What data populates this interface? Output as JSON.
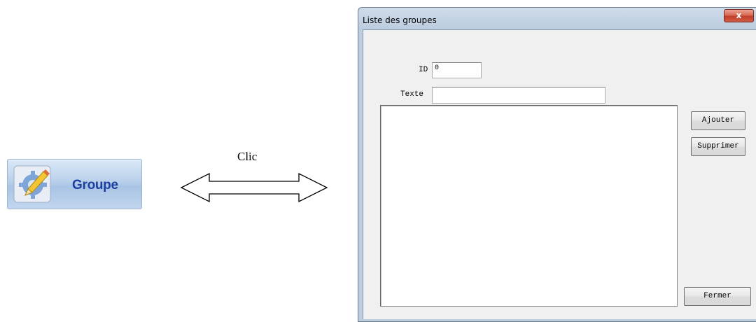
{
  "launcher": {
    "label": "Groupe",
    "icon": "edit-settings-icon"
  },
  "annotation": {
    "label": "Clic"
  },
  "dialog": {
    "title": "Liste des groupes",
    "close_label": "x",
    "id_label": "ID",
    "id_value": "0",
    "texte_label": "Texte",
    "texte_value": "",
    "buttons": {
      "add": "Ajouter",
      "delete": "Supprimer",
      "close": "Fermer"
    },
    "list_items": []
  }
}
